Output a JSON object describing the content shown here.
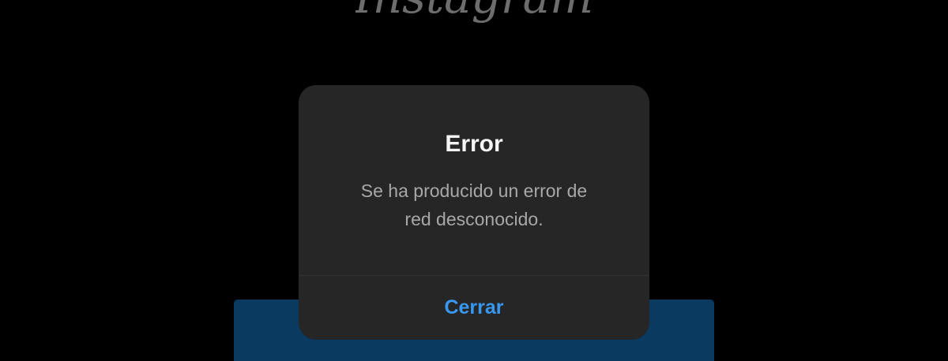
{
  "app": {
    "logo_text": "Instagram"
  },
  "dialog": {
    "title": "Error",
    "message": "Se ha producido un error de red desconocido.",
    "close_label": "Cerrar"
  },
  "colors": {
    "background": "#000000",
    "dialog_bg": "#262626",
    "title_text": "#f5f5f5",
    "message_text": "#a8a8a8",
    "accent_blue": "#3897f0",
    "login_button_bg": "#0a3a60"
  }
}
